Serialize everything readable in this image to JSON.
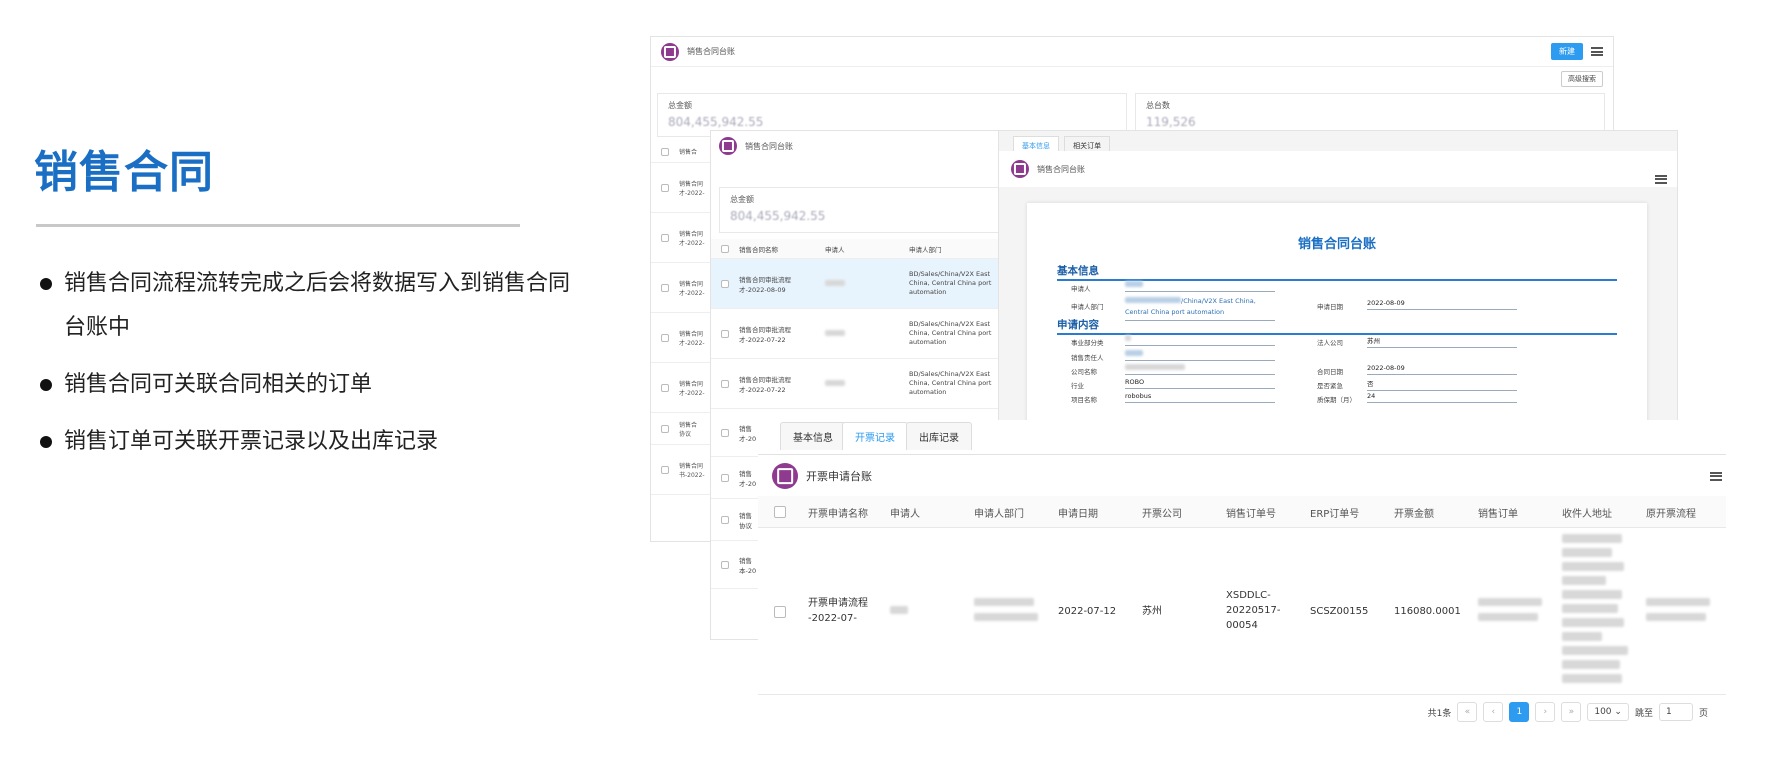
{
  "slide": {
    "title": "销售合同",
    "bullets": [
      "销售合同流程流转完成之后会将数据写入到销售合同台账中",
      "销售合同可关联合同相关的订单",
      "销售订单可关联开票记录以及出库记录"
    ]
  },
  "window_ledger": {
    "title": "销售合同台账",
    "new_button": "新建",
    "advanced_search": "高级搜索",
    "stat_total_amount_label": "总金额",
    "stat_total_amount": "804,455,942.55",
    "stat_count_label": "总台数",
    "stat_count": "119,526",
    "col_name": "销售合",
    "rows": [
      "销售合同\n才-2022-",
      "销售合同\n才-2022-",
      "销售合同\n才-2022-",
      "销售合同\n才-2022-",
      "销售合同\n才-2022-",
      "销售合\n协议",
      "销售合同\n书-2022-"
    ]
  },
  "window_list": {
    "title": "销售合同台账",
    "stat_total_amount_label": "总金额",
    "stat_total_amount": "804,455,942.55",
    "columns": [
      "销售合同名称",
      "申请人",
      "申请人部门"
    ],
    "rows": [
      {
        "name": "销售合同审批流程\n才-2022-08-09",
        "dept": "BD/Sales/China/V2X East China, Central China port automation"
      },
      {
        "name": "销售合同审批流程\n才-2022-07-22",
        "dept": "BD/Sales/China/V2X East China, Central China port automation"
      },
      {
        "name": "销售合同审批流程\n才-2022-07-22",
        "dept": "BD/Sales/China/V2X East China, Central China port automation"
      }
    ],
    "extra_rows": [
      "销售\n才-20",
      "销售\n才-20",
      "销售\n协议",
      "销售\n本-20"
    ]
  },
  "window_detail": {
    "tabs": [
      "基本信息",
      "相关订单"
    ],
    "title": "销售合同台账",
    "doc_title": "销售合同台账",
    "section_basic": "基本信息",
    "section_content": "申请内容",
    "fields_basic": {
      "applicant_label": "申请人",
      "dept_label": "申请人部门",
      "dept_value": "/China/V2X East China, Central China port automation",
      "date_label": "申请日期",
      "date_value": "2022-08-09"
    },
    "fields_content": {
      "bu_label": "事业部分类",
      "legal_label": "法人公司",
      "legal_value": "苏州",
      "owner_label": "销售责任人",
      "company_label": "公司名称",
      "contract_date_label": "合同日期",
      "contract_date_value": "2022-08-09",
      "industry_label": "行业",
      "industry_value": "ROBO",
      "urgent_label": "是否紧急",
      "urgent_value": "否",
      "project_label": "项目名称",
      "project_value": "robobus",
      "warranty_label": "质保期（月）",
      "warranty_value": "24"
    }
  },
  "window_invoice": {
    "tabs": [
      "基本信息",
      "开票记录",
      "出库记录"
    ],
    "active_tab": "开票记录",
    "title": "开票申请台账",
    "columns": [
      "开票申请名称",
      "申请人",
      "申请人部门",
      "申请日期",
      "开票公司",
      "销售订单号",
      "ERP订单号",
      "开票金额",
      "销售订单",
      "收件人地址",
      "原开票流程"
    ],
    "row": {
      "name": "开票申请流程\n-2022-07-",
      "date": "2022-07-12",
      "company": "苏州",
      "order_no": "XSDDLC-\n20220517-\n00054",
      "erp_no": "SCSZ00155",
      "amount": "116080.0001"
    },
    "pager": {
      "total": "共1条",
      "current_page": "1",
      "page_size": "100",
      "jump_label": "跳至",
      "jump_value": "1",
      "page_unit": "页"
    }
  },
  "colors": {
    "accent": "#2d9bf0",
    "title": "#1a6fc4",
    "logo": "#8e3a8e"
  }
}
